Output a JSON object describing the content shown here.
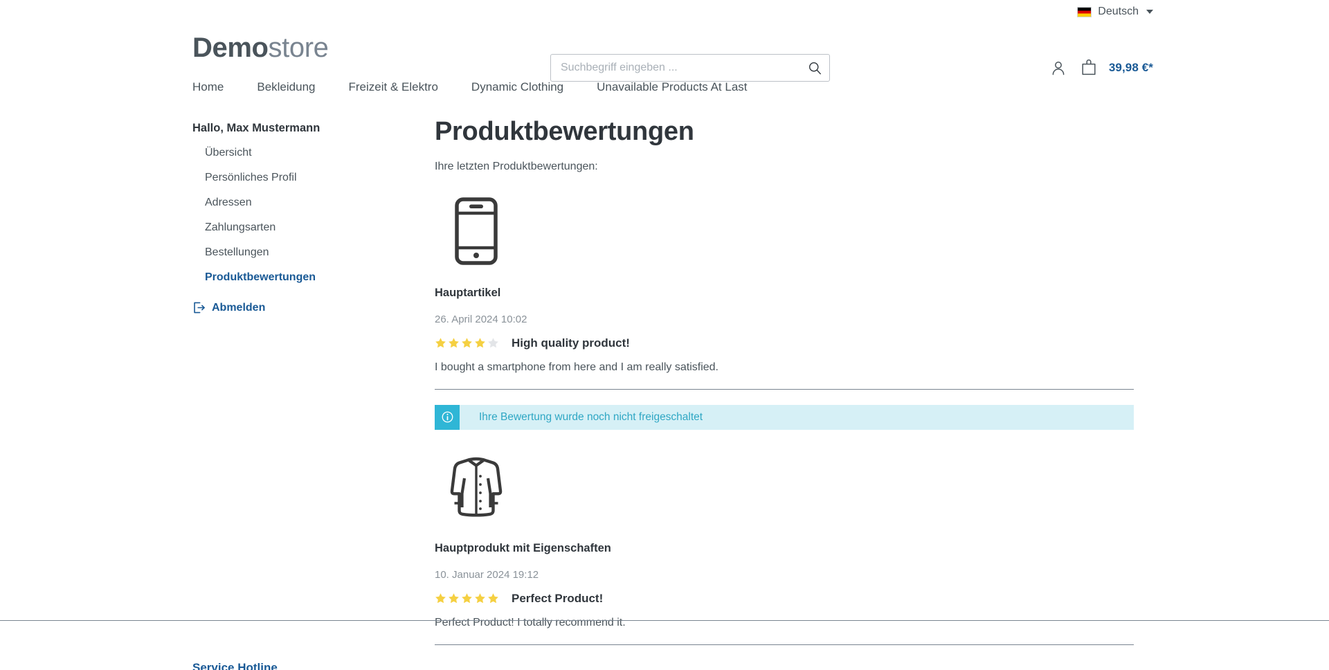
{
  "topbar": {
    "language": {
      "label": "Deutsch",
      "flag": "de-flag-icon",
      "caret": "chevron-down-icon"
    }
  },
  "header": {
    "logo": {
      "bold": "Demo",
      "light": "store"
    },
    "search": {
      "placeholder": "Suchbegriff eingeben ...",
      "value": "",
      "icon": "search-icon"
    },
    "account_icon": "user-icon",
    "cart_icon": "shopping-bag-icon",
    "cart_total": "39,98 €*"
  },
  "nav": {
    "items": [
      {
        "label": "Home"
      },
      {
        "label": "Bekleidung"
      },
      {
        "label": "Freizeit & Elektro"
      },
      {
        "label": "Dynamic Clothing"
      },
      {
        "label": "Unavailable Products At Last"
      }
    ]
  },
  "sidebar": {
    "greeting": "Hallo, Max Mustermann",
    "items": [
      {
        "label": "Übersicht",
        "active": false
      },
      {
        "label": "Persönliches Profil",
        "active": false
      },
      {
        "label": "Adressen",
        "active": false
      },
      {
        "label": "Zahlungsarten",
        "active": false
      },
      {
        "label": "Bestellungen",
        "active": false
      },
      {
        "label": "Produktbewertungen",
        "active": true
      }
    ],
    "logout": {
      "label": "Abmelden",
      "icon": "logout-icon"
    }
  },
  "main": {
    "title": "Produktbewertungen",
    "intro": "Ihre letzten Produktbewertungen:",
    "reviews": [
      {
        "product_name": "Hauptartikel",
        "thumb_icon": "smartphone-icon",
        "date": "26. April 2024 10:02",
        "rating": 4,
        "max_rating": 5,
        "headline": "High quality product!",
        "body": "I bought a smartphone from here and I am really satisfied.",
        "notice": "Ihre Bewertung wurde noch nicht freigeschaltet"
      },
      {
        "product_name": "Hauptprodukt mit Eigenschaften",
        "thumb_icon": "jacket-icon",
        "date": "10. Januar 2024 19:12",
        "rating": 5,
        "max_rating": 5,
        "headline": "Perfect Product!",
        "body": "Perfect Product! I totally recommend it.",
        "notice": null
      }
    ]
  },
  "footer": {
    "heading": "Service Hotline"
  },
  "colors": {
    "accent_blue": "#1a5a96",
    "text": "#4a545b",
    "heading": "#30363c",
    "star_filled": "#f5d042",
    "star_empty": "#e3e5e8",
    "info_bg": "#d6f0f6",
    "info_icon_bg": "#2fb6d6",
    "info_text": "#2fa7c4",
    "muted": "#8a9299"
  }
}
